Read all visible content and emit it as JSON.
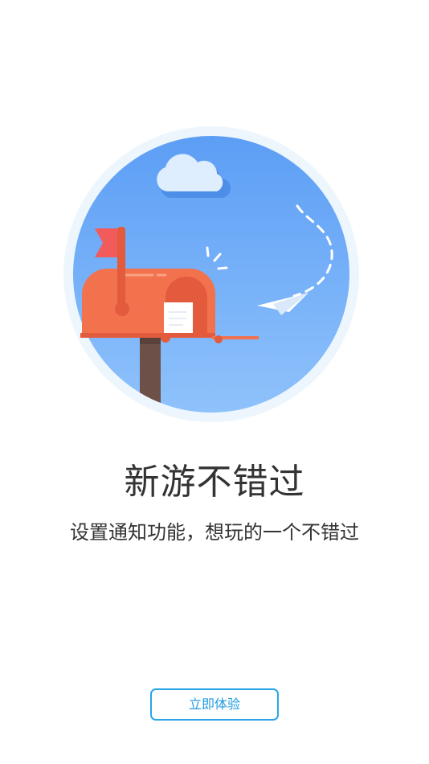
{
  "onboarding": {
    "title": "新游不错过",
    "subtitle": "设置通知功能，想玩的一个不错过",
    "cta_label": "立即体验",
    "illustration_icon": "mailbox-with-paper-plane-icon"
  },
  "colors": {
    "sky": "#6aa8f6",
    "sky_ring": "#eef6fd",
    "mailbox": "#f3724e",
    "flag": "#f25b5b",
    "accent_button": "#29a6e8",
    "text": "#333333"
  }
}
